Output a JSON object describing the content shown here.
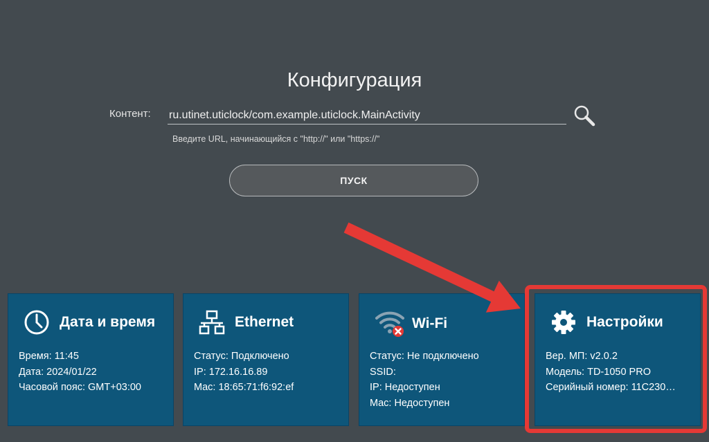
{
  "page": {
    "title": "Конфигурация"
  },
  "content": {
    "label": "Контент:",
    "url_value": "ru.utinet.uticlock/com.example.uticlock.MainActivity",
    "hint": "Введите URL, начинающийся с \"http://\" или \"https://\"",
    "search_icon": "search-icon"
  },
  "start_button": {
    "label": "ПУСК"
  },
  "tiles": {
    "datetime": {
      "icon": "clock-icon",
      "title": "Дата и время",
      "lines": [
        "Время: 11:45",
        "Дата: 2024/01/22",
        "Часовой пояс: GMT+03:00"
      ]
    },
    "ethernet": {
      "icon": "network-icon",
      "title": "Ethernet",
      "lines": [
        "Статус: Подключено",
        "IP: 172.16.16.89",
        "Mac: 18:65:71:f6:92:ef"
      ]
    },
    "wifi": {
      "icon": "wifi-off-icon",
      "title": "Wi-Fi",
      "lines": [
        "Статус: Не подключено",
        "SSID:",
        "IP: Недоступен",
        "Mac: Недоступен"
      ]
    },
    "settings": {
      "icon": "gear-icon",
      "title": "Настройки",
      "lines": [
        "Вер. МП: v2.0.2",
        "Модель: TD-1050 PRO",
        "Серийный номер: 11С230…"
      ]
    }
  },
  "annotation": {
    "arrow_color": "#e53935",
    "highlight_color": "#e53935"
  }
}
